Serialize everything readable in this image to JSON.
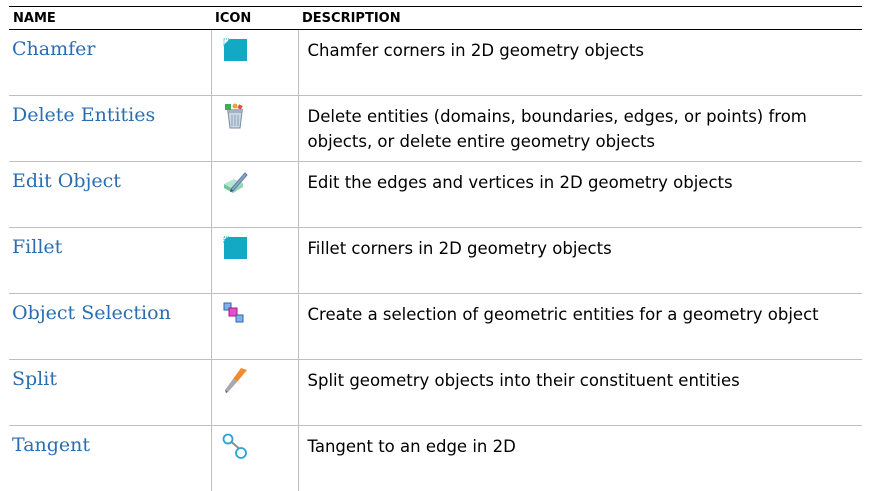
{
  "table": {
    "headers": {
      "name": "NAME",
      "icon": "ICON",
      "description": "DESCRIPTION"
    },
    "rows": [
      {
        "name": "Chamfer",
        "icon": "chamfer-icon",
        "description": "Chamfer corners in 2D geometry objects"
      },
      {
        "name": "Delete Entities",
        "icon": "delete-entities-icon",
        "description": "Delete entities (domains, boundaries, edges, or points) from objects, or delete entire geometry objects"
      },
      {
        "name": "Edit Object",
        "icon": "edit-object-icon",
        "description": "Edit the edges and vertices in 2D geometry objects"
      },
      {
        "name": "Fillet",
        "icon": "fillet-icon",
        "description": "Fillet corners in 2D geometry objects"
      },
      {
        "name": "Object Selection",
        "icon": "object-selection-icon",
        "description": "Create a selection of geometric entities for a geometry object"
      },
      {
        "name": "Split",
        "icon": "split-icon",
        "description": "Split geometry objects into their constituent entities"
      },
      {
        "name": "Tangent",
        "icon": "tangent-icon",
        "description": "Tangent to an edge in 2D"
      }
    ]
  }
}
